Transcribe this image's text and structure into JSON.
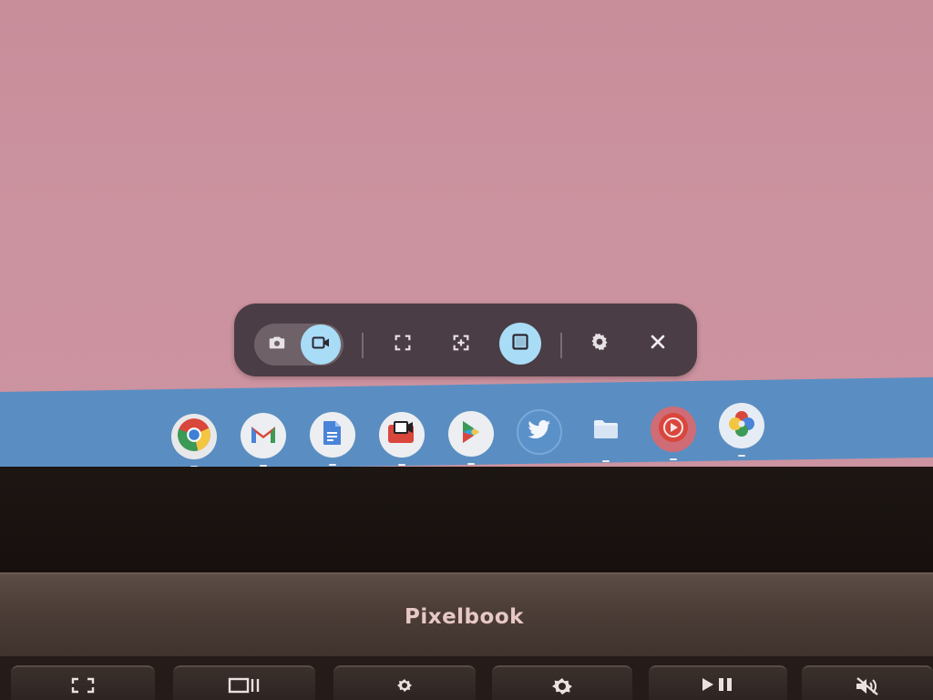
{
  "capture_toolbar": {
    "modes": [
      {
        "name": "screenshot",
        "icon": "camera-icon",
        "active": false
      },
      {
        "name": "screen-record",
        "icon": "video-camera-icon",
        "active": true
      }
    ],
    "sources": [
      {
        "name": "full-screen",
        "icon": "fullscreen-capture-icon",
        "active": false
      },
      {
        "name": "partial-screen",
        "icon": "partial-capture-icon",
        "active": false
      },
      {
        "name": "window",
        "icon": "window-capture-icon",
        "active": true
      }
    ],
    "settings_icon": "gear-icon",
    "close_icon": "close-icon",
    "active_color": "#a9dcf6"
  },
  "shelf": {
    "apps": [
      {
        "name": "chrome",
        "icon": "chrome-icon",
        "running": true
      },
      {
        "name": "gmail",
        "icon": "gmail-icon",
        "running": true
      },
      {
        "name": "docs",
        "icon": "docs-icon",
        "running": true
      },
      {
        "name": "screen-recorder",
        "icon": "screen-recorder-icon",
        "running": true
      },
      {
        "name": "play-store",
        "icon": "play-store-icon",
        "running": true
      },
      {
        "name": "twitter",
        "icon": "twitter-icon",
        "running": false
      },
      {
        "name": "files",
        "icon": "files-icon",
        "running": true
      },
      {
        "name": "youtube-music",
        "icon": "youtube-music-icon",
        "running": true
      },
      {
        "name": "photos",
        "icon": "photos-icon",
        "running": true
      }
    ],
    "color": "#5a8ec2"
  },
  "device": {
    "brand": "Pixelbook"
  },
  "keyboard": {
    "keys": [
      {
        "name": "fullscreen-key",
        "icon": "fullscreen-icon"
      },
      {
        "name": "overview-key",
        "icon": "overview-icon"
      },
      {
        "name": "brightness-down-key",
        "icon": "brightness-low-icon"
      },
      {
        "name": "brightness-up-key",
        "icon": "brightness-high-icon"
      },
      {
        "name": "play-pause-key",
        "icon": "play-pause-icon"
      },
      {
        "name": "mute-key",
        "icon": "mute-icon"
      }
    ]
  }
}
